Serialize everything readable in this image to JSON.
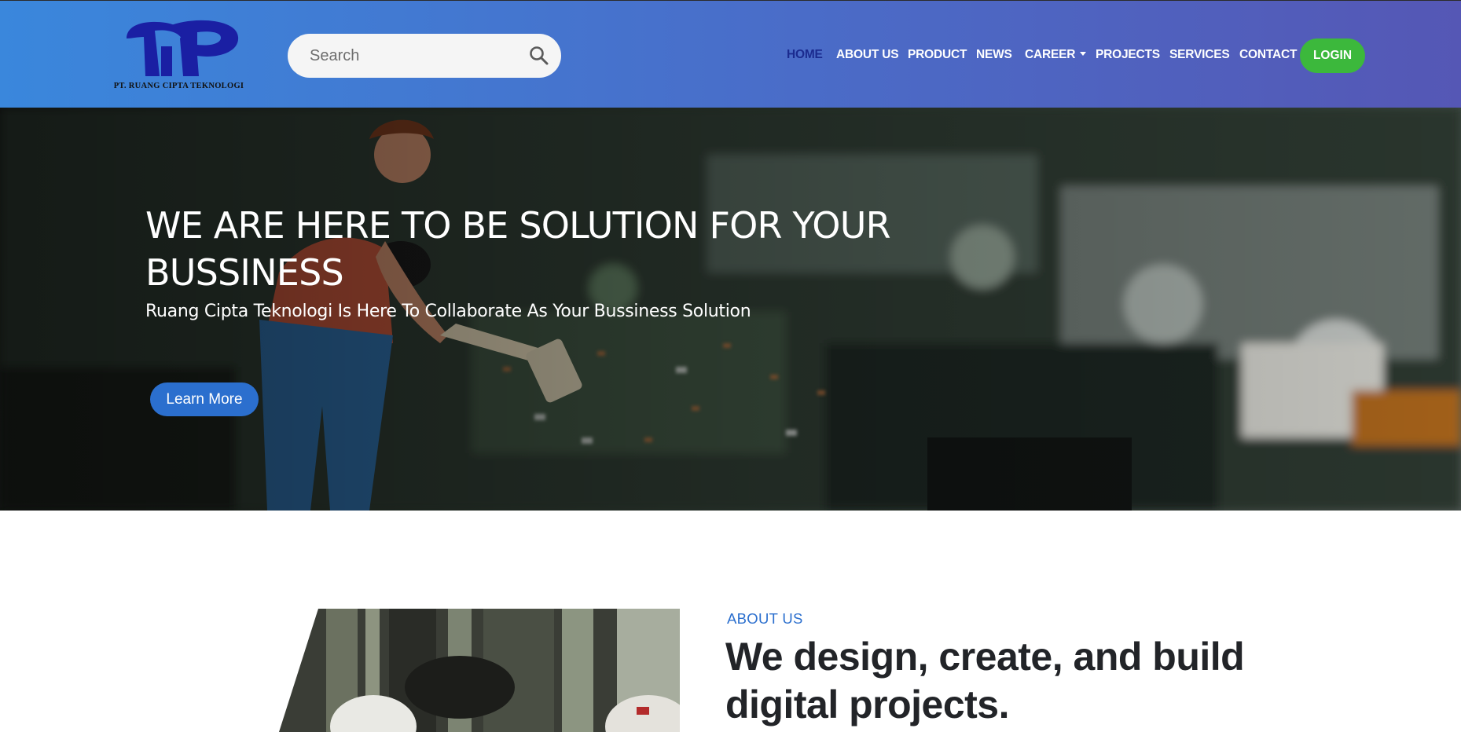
{
  "brand": {
    "logo_text": "PT. RUANG CIPTA TEKNOLOGI",
    "logo_color": "#1a1fa3"
  },
  "search": {
    "placeholder": "Search",
    "icon": "search-icon"
  },
  "nav": {
    "items": [
      {
        "label": "HOME",
        "active": true
      },
      {
        "label": "ABOUT US"
      },
      {
        "label": "PRODUCT"
      },
      {
        "label": "NEWS"
      },
      {
        "label": "CAREER",
        "dropdown": true
      },
      {
        "label": "PROJECTS"
      },
      {
        "label": "SERVICES"
      },
      {
        "label": "CONTACT"
      }
    ],
    "login_label": "LOGIN",
    "active_color": "#1b2b8f",
    "login_color": "#3cb83c"
  },
  "hero": {
    "title": "WE ARE HERE TO BE SOLUTION FOR YOUR BUSSINESS",
    "subtitle": "Ruang Cipta Teknologi Is Here To Collaborate As Your Bussiness Solution",
    "cta_label": "Learn More",
    "cta_color": "#2b6fce"
  },
  "about": {
    "label": "ABOUT US",
    "title": "We design, create, and build digital projects.",
    "accent_color": "#2b6fce"
  }
}
